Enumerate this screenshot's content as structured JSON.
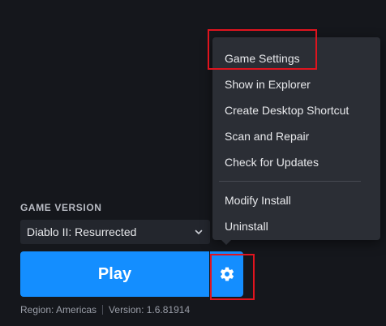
{
  "game_version": {
    "label": "GAME VERSION",
    "selected": "Diablo II: Resurrected"
  },
  "play_button": {
    "label": "Play"
  },
  "footer": {
    "region": "Region: Americas",
    "version": "Version: 1.6.81914"
  },
  "menu": {
    "items": [
      {
        "label": "Game Settings"
      },
      {
        "label": "Show in Explorer"
      },
      {
        "label": "Create Desktop Shortcut"
      },
      {
        "label": "Scan and Repair"
      },
      {
        "label": "Check for Updates"
      },
      {
        "label": "Modify Install"
      },
      {
        "label": "Uninstall"
      }
    ]
  },
  "colors": {
    "background": "#15171c",
    "play_blue": "#148eff",
    "menu_bg": "#2b2e35",
    "highlight_red": "#e0141e"
  },
  "icons": {
    "settings": "gear-icon",
    "dropdown": "chevron-down-icon"
  }
}
